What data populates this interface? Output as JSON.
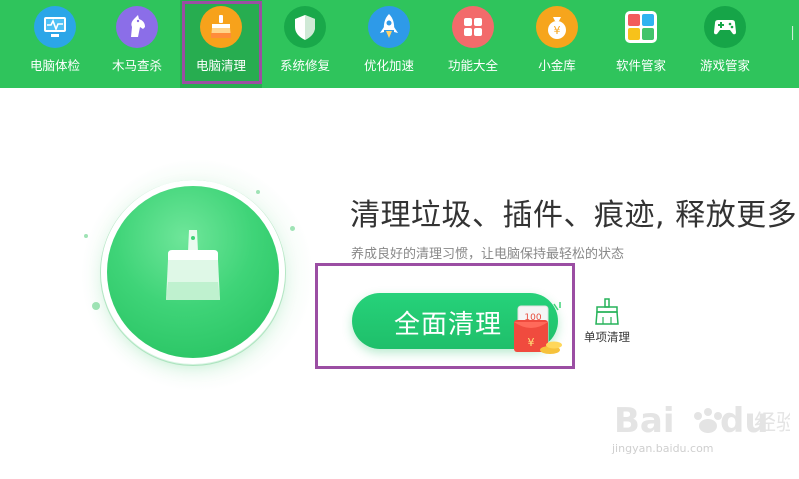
{
  "toolbar": {
    "items": [
      {
        "label": "电脑体检",
        "icon": "monitor-icon"
      },
      {
        "label": "木马查杀",
        "icon": "horse-icon"
      },
      {
        "label": "电脑清理",
        "icon": "broom-icon"
      },
      {
        "label": "系统修复",
        "icon": "shield-icon"
      },
      {
        "label": "优化加速",
        "icon": "rocket-icon"
      },
      {
        "label": "功能大全",
        "icon": "grid-icon"
      },
      {
        "label": "小金库",
        "icon": "money-bag-icon"
      },
      {
        "label": "软件管家",
        "icon": "app-tiles-icon"
      },
      {
        "label": "游戏管家",
        "icon": "gamepad-icon"
      }
    ],
    "active": "电脑清理"
  },
  "main": {
    "headline": "清理垃圾、插件、痕迹, 释放更多空",
    "subline": "养成良好的清理习惯，让电脑保持最轻松的状态",
    "primary_button": "全面清理",
    "redpacket_amount": "100",
    "redpacket_symbol": "¥",
    "single_clean_label": "单项清理"
  },
  "watermark": {
    "brand": "Bai du 经验",
    "url": "jingyan.baidu.com"
  },
  "colors": {
    "toolbar_bg": "#2fc45c",
    "accent": "#1fbf6a",
    "highlight_box": "#9b4ea3"
  }
}
